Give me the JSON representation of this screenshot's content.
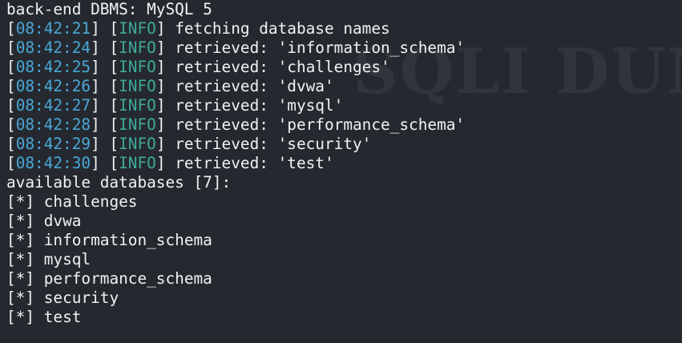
{
  "header": "back-end DBMS: MySQL 5",
  "watermark": "SQLI DUMP",
  "log": [
    {
      "time": "08:42:21",
      "level": "INFO",
      "message": "fetching database names"
    },
    {
      "time": "08:42:24",
      "level": "INFO",
      "message": "retrieved: 'information_schema'"
    },
    {
      "time": "08:42:25",
      "level": "INFO",
      "message": "retrieved: 'challenges'"
    },
    {
      "time": "08:42:26",
      "level": "INFO",
      "message": "retrieved: 'dvwa'"
    },
    {
      "time": "08:42:27",
      "level": "INFO",
      "message": "retrieved: 'mysql'"
    },
    {
      "time": "08:42:28",
      "level": "INFO",
      "message": "retrieved: 'performance_schema'"
    },
    {
      "time": "08:42:29",
      "level": "INFO",
      "message": "retrieved: 'security'"
    },
    {
      "time": "08:42:30",
      "level": "INFO",
      "message": "retrieved: 'test'"
    }
  ],
  "summary": "available databases [7]:",
  "bullet": "[*]",
  "databases": [
    "challenges",
    "dvwa",
    "information_schema",
    "mysql",
    "performance_schema",
    "security",
    "test"
  ],
  "colors": {
    "background": "#25292f",
    "text": "#f2f2f2",
    "timestamp": "#4aa8d8",
    "level": "#3fa99a"
  }
}
